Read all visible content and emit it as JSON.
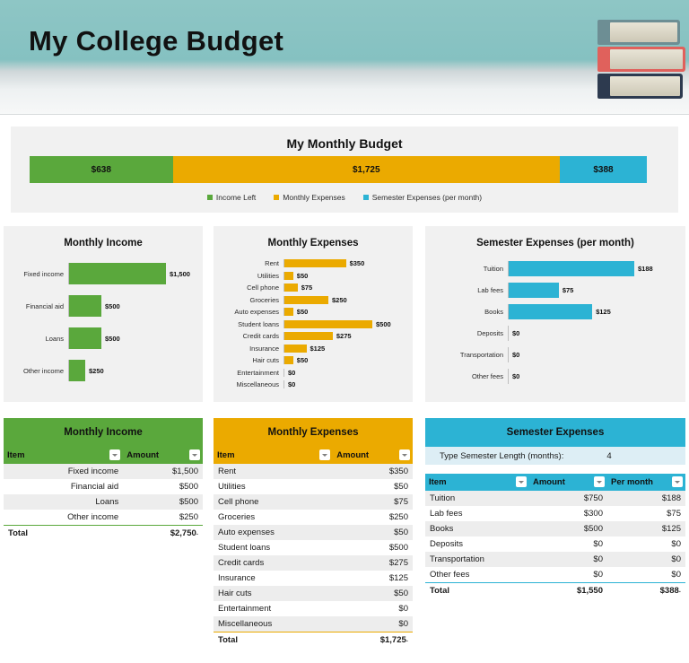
{
  "header": {
    "title": "My College Budget",
    "books_icon": "stack-of-books-icon"
  },
  "summary": {
    "title": "My Monthly Budget",
    "segments": [
      {
        "label": "$638",
        "value": 638,
        "color": "#5aa83c",
        "legend": "Income Left"
      },
      {
        "label": "$1,725",
        "value": 1725,
        "color": "#ebaa00",
        "legend": "Monthly Expenses"
      },
      {
        "label": "$388",
        "value": 388,
        "color": "#2cb3d4",
        "legend": "Semester Expenses (per month)"
      }
    ]
  },
  "colors": {
    "income_green": "#5aa83c",
    "expenses_gold": "#ebaa00",
    "semester_cyan": "#2cb3d4",
    "banner_teal": "#85c1c1",
    "panel_gray": "#f1f1f1"
  },
  "chart_data": [
    {
      "type": "bar",
      "title": "Monthly Income",
      "orientation": "horizontal",
      "categories": [
        "Fixed income",
        "Financial aid",
        "Loans",
        "Other income"
      ],
      "values": [
        1500,
        500,
        500,
        250
      ],
      "labels": [
        "$1,500",
        "$500",
        "$500",
        "$250"
      ],
      "color": "#5aa83c",
      "xlabel": "",
      "ylabel": "",
      "xlim": [
        0,
        1500
      ],
      "grid": false,
      "legend": "none"
    },
    {
      "type": "bar",
      "title": "Monthly Expenses",
      "orientation": "horizontal",
      "categories": [
        "Rent",
        "Utilities",
        "Cell phone",
        "Groceries",
        "Auto expenses",
        "Student loans",
        "Credit cards",
        "Insurance",
        "Hair cuts",
        "Entertainment",
        "Miscellaneous"
      ],
      "values": [
        350,
        50,
        75,
        250,
        50,
        500,
        275,
        125,
        50,
        0,
        0
      ],
      "labels": [
        "$350",
        "$50",
        "$75",
        "$250",
        "$50",
        "$500",
        "$275",
        "$125",
        "$50",
        "$0",
        "$0"
      ],
      "color": "#ebaa00",
      "xlabel": "",
      "ylabel": "",
      "xlim": [
        0,
        500
      ],
      "grid": false,
      "legend": "none"
    },
    {
      "type": "bar",
      "title": "Semester Expenses (per month)",
      "orientation": "horizontal",
      "categories": [
        "Tuition",
        "Lab fees",
        "Books",
        "Deposits",
        "Transportation",
        "Other fees"
      ],
      "values": [
        188,
        75,
        125,
        0,
        0,
        0
      ],
      "labels": [
        "$188",
        "$75",
        "$125",
        "$0",
        "$0",
        "$0"
      ],
      "color": "#2cb3d4",
      "xlabel": "",
      "ylabel": "",
      "xlim": [
        0,
        188
      ],
      "grid": false,
      "legend": "none"
    }
  ],
  "tables": {
    "income": {
      "banner": "Monthly Income",
      "columns": [
        "Item",
        "Amount"
      ],
      "rows": [
        {
          "item": "Fixed income",
          "amount": "$1,500"
        },
        {
          "item": "Financial aid",
          "amount": "$500"
        },
        {
          "item": "Loans",
          "amount": "$500"
        },
        {
          "item": "Other income",
          "amount": "$250"
        }
      ],
      "total_label": "Total",
      "total_amount": "$2,750"
    },
    "expenses": {
      "banner": "Monthly Expenses",
      "columns": [
        "Item",
        "Amount"
      ],
      "rows": [
        {
          "item": "Rent",
          "amount": "$350"
        },
        {
          "item": "Utilities",
          "amount": "$50"
        },
        {
          "item": "Cell phone",
          "amount": "$75"
        },
        {
          "item": "Groceries",
          "amount": "$250"
        },
        {
          "item": "Auto expenses",
          "amount": "$50"
        },
        {
          "item": "Student loans",
          "amount": "$500"
        },
        {
          "item": "Credit cards",
          "amount": "$275"
        },
        {
          "item": "Insurance",
          "amount": "$125"
        },
        {
          "item": "Hair cuts",
          "amount": "$50"
        },
        {
          "item": "Entertainment",
          "amount": "$0"
        },
        {
          "item": "Miscellaneous",
          "amount": "$0"
        }
      ],
      "total_label": "Total",
      "total_amount": "$1,725"
    },
    "semester": {
      "banner": "Semester Expenses",
      "length_label": "Type Semester Length (months):",
      "length_value": "4",
      "columns": [
        "Item",
        "Amount",
        "Per month"
      ],
      "rows": [
        {
          "item": "Tuition",
          "amount": "$750",
          "per_month": "$188"
        },
        {
          "item": "Lab fees",
          "amount": "$300",
          "per_month": "$75"
        },
        {
          "item": "Books",
          "amount": "$500",
          "per_month": "$125"
        },
        {
          "item": "Deposits",
          "amount": "$0",
          "per_month": "$0"
        },
        {
          "item": "Transportation",
          "amount": "$0",
          "per_month": "$0"
        },
        {
          "item": "Other fees",
          "amount": "$0",
          "per_month": "$0"
        }
      ],
      "total_label": "Total",
      "total_amount": "$1,550",
      "total_per_month": "$388"
    }
  }
}
